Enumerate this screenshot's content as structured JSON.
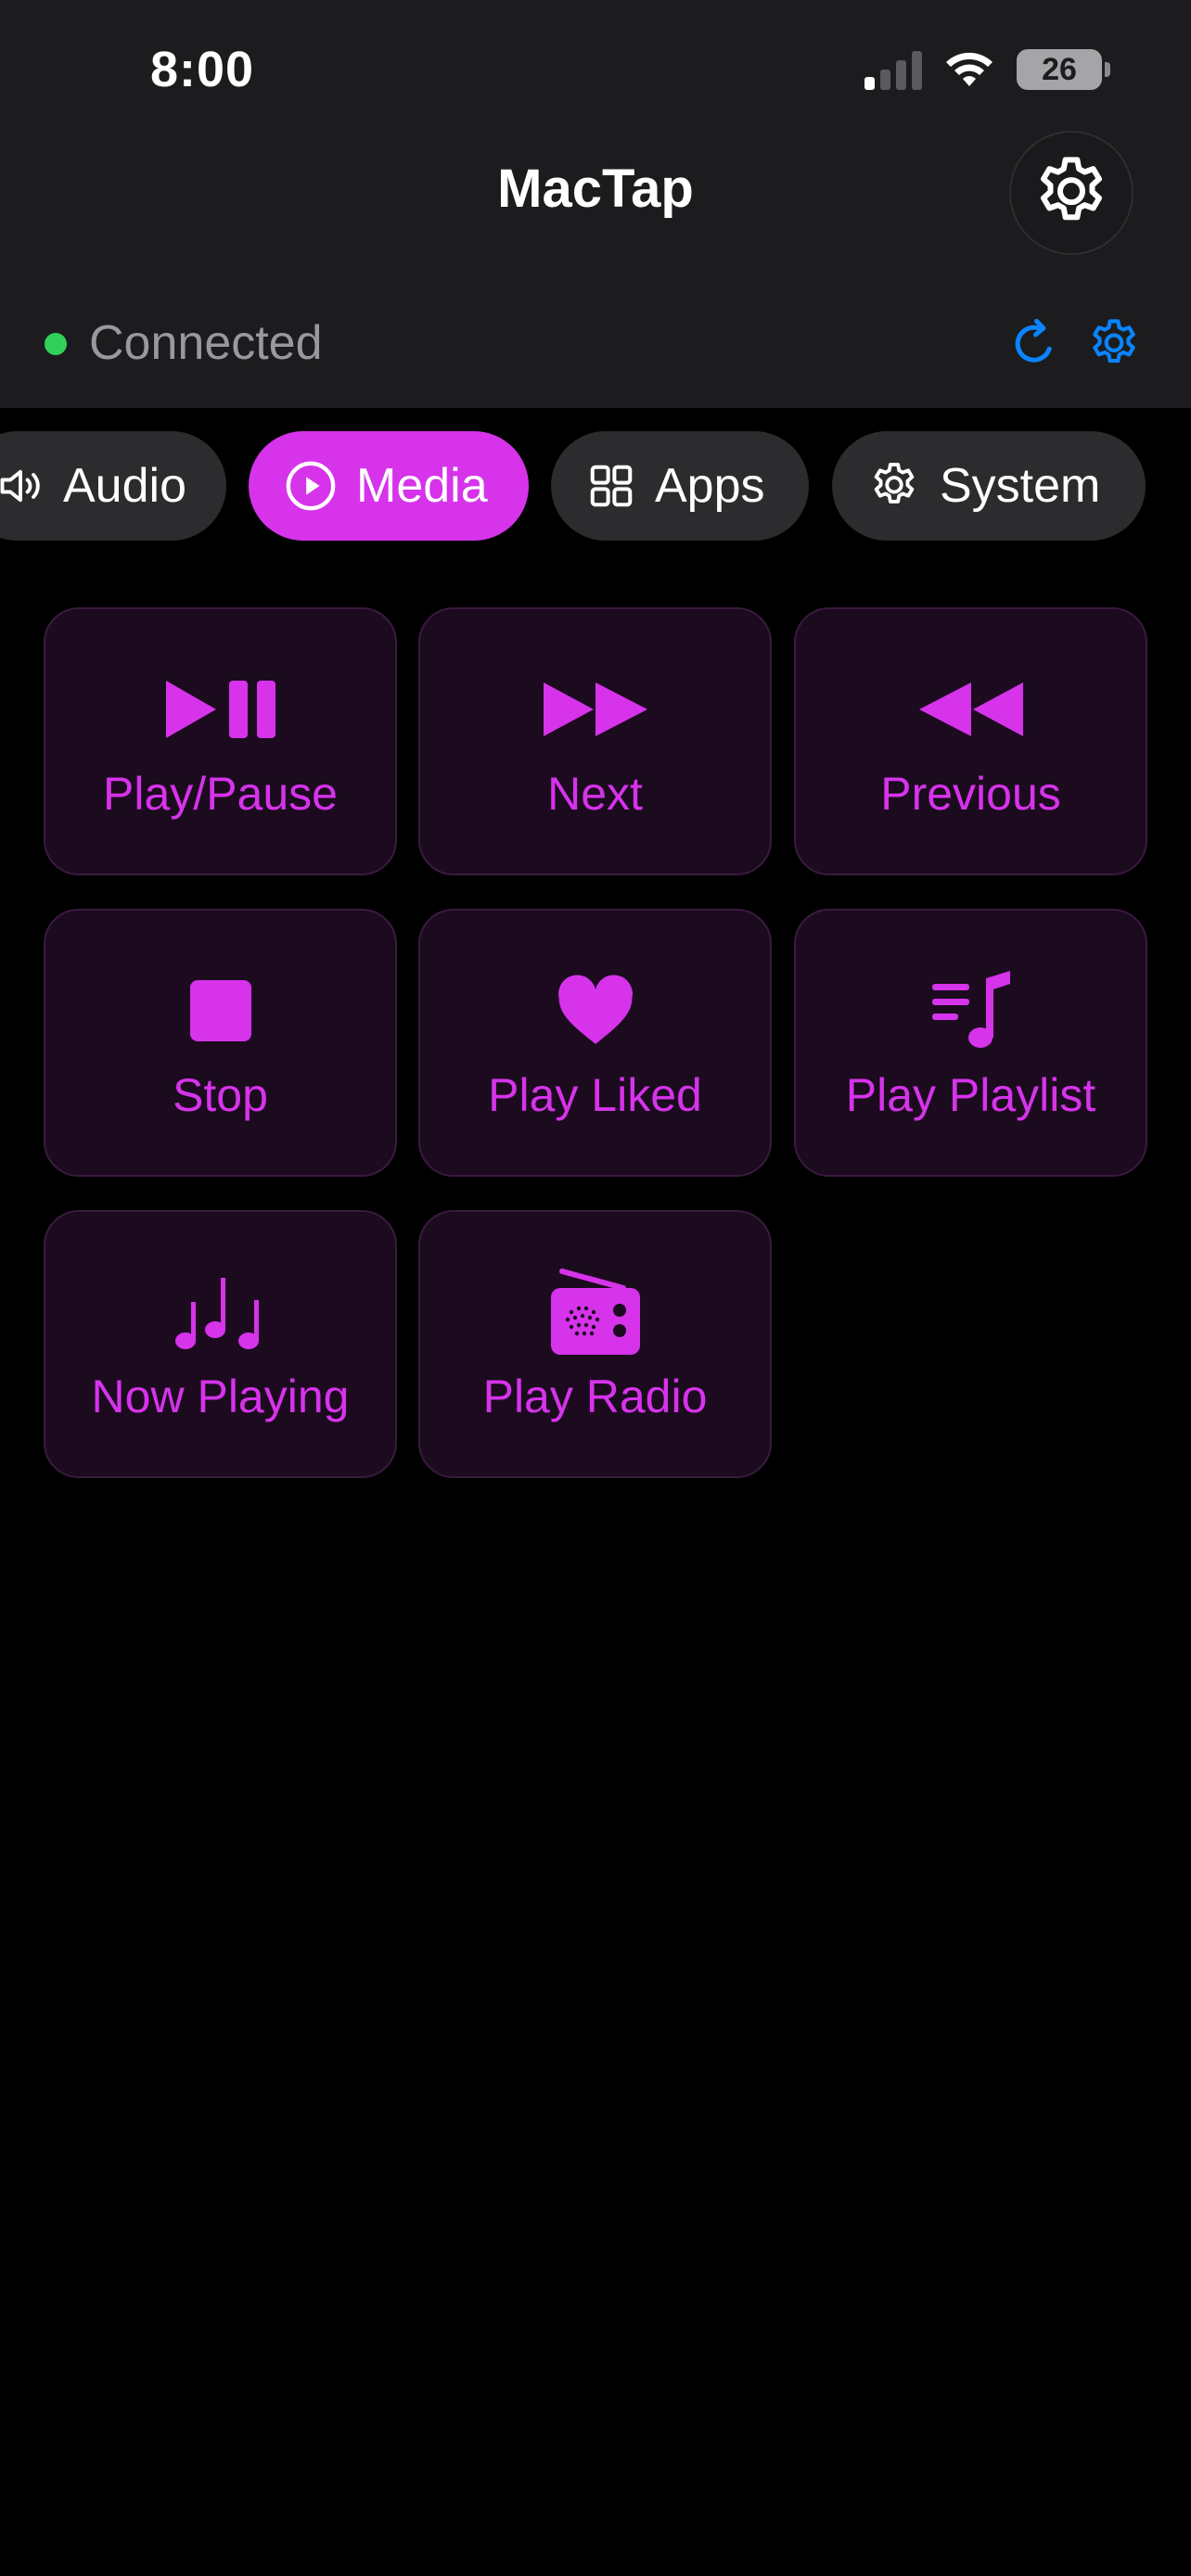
{
  "status_bar": {
    "time": "8:00",
    "battery": "26"
  },
  "nav": {
    "title": "MacTap",
    "settings_icon": "gear-icon"
  },
  "connection": {
    "status": "Connected",
    "status_color": "#30d158",
    "refresh_icon": "refresh-icon",
    "settings_icon": "gear-icon"
  },
  "tabs": [
    {
      "label": "Audio",
      "icon": "speaker-icon",
      "active": false
    },
    {
      "label": "Media",
      "icon": "play-circle-icon",
      "active": true
    },
    {
      "label": "Apps",
      "icon": "grid-icon",
      "active": false
    },
    {
      "label": "System",
      "icon": "gear-icon",
      "active": false
    }
  ],
  "buttons": [
    {
      "label": "Play/Pause",
      "icon": "play-pause-icon"
    },
    {
      "label": "Next",
      "icon": "forward-icon"
    },
    {
      "label": "Previous",
      "icon": "backward-icon"
    },
    {
      "label": "Stop",
      "icon": "stop-icon"
    },
    {
      "label": "Play Liked",
      "icon": "heart-icon"
    },
    {
      "label": "Play Playlist",
      "icon": "playlist-icon"
    },
    {
      "label": "Now Playing",
      "icon": "music-notes-icon"
    },
    {
      "label": "Play Radio",
      "icon": "radio-icon"
    }
  ],
  "colors": {
    "accent": "#d633eb",
    "tile_background": "#1c0a1f",
    "header_background": "#1c1c1e",
    "tab_background": "#2c2c2e",
    "link_blue": "#0a84ff"
  }
}
